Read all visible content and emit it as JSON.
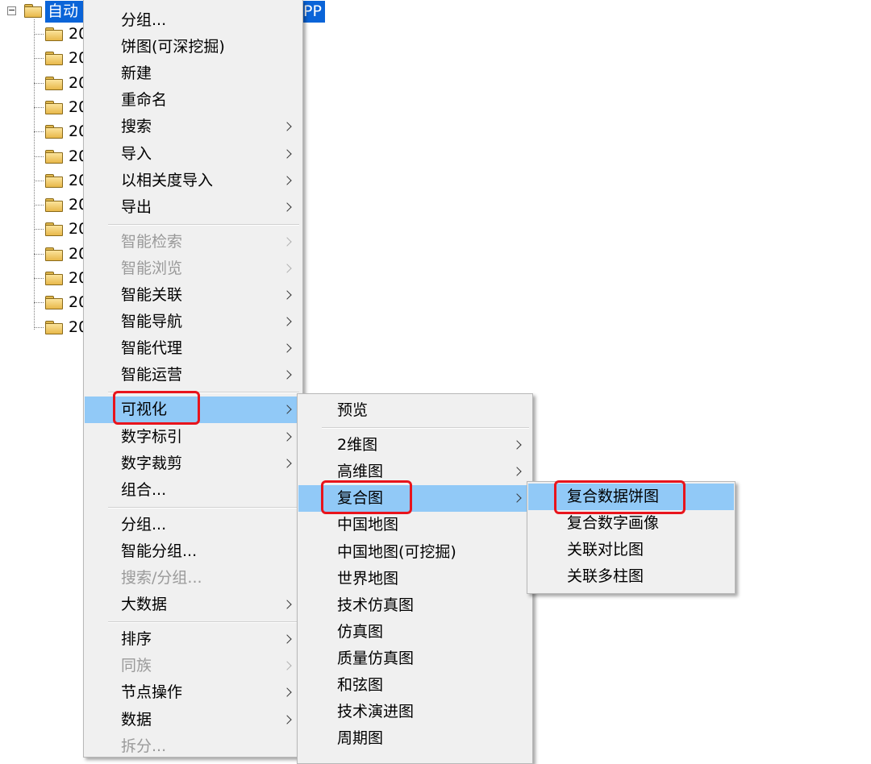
{
  "tree": {
    "root_label": "自动",
    "root_label_tail": "PP",
    "children": [
      "20",
      "20",
      "20",
      "20",
      "20",
      "20",
      "20",
      "20",
      "20",
      "20",
      "20",
      "20",
      "20"
    ]
  },
  "menu1": {
    "items": [
      {
        "label": "分组...",
        "submenu": false,
        "disabled": false
      },
      {
        "label": "饼图(可深挖掘)",
        "submenu": false,
        "disabled": false
      },
      {
        "label": "新建",
        "submenu": false,
        "disabled": false
      },
      {
        "label": "重命名",
        "submenu": false,
        "disabled": false
      },
      {
        "label": "搜索",
        "submenu": true,
        "disabled": false
      },
      {
        "label": "导入",
        "submenu": true,
        "disabled": false
      },
      {
        "label": "以相关度导入",
        "submenu": true,
        "disabled": false
      },
      {
        "label": "导出",
        "submenu": true,
        "disabled": false
      },
      {
        "label": "智能检索",
        "submenu": true,
        "disabled": true
      },
      {
        "label": "智能浏览",
        "submenu": true,
        "disabled": true
      },
      {
        "label": "智能关联",
        "submenu": true,
        "disabled": false
      },
      {
        "label": "智能导航",
        "submenu": true,
        "disabled": false
      },
      {
        "label": "智能代理",
        "submenu": true,
        "disabled": false
      },
      {
        "label": "智能运营",
        "submenu": true,
        "disabled": false
      },
      {
        "label": "可视化",
        "submenu": true,
        "disabled": false,
        "highlighted": true
      },
      {
        "label": "数字标引",
        "submenu": true,
        "disabled": false
      },
      {
        "label": "数字裁剪",
        "submenu": true,
        "disabled": false
      },
      {
        "label": "组合...",
        "submenu": false,
        "disabled": false
      },
      {
        "label": "分组...",
        "submenu": false,
        "disabled": false
      },
      {
        "label": "智能分组...",
        "submenu": false,
        "disabled": false
      },
      {
        "label": "搜索/分组...",
        "submenu": false,
        "disabled": true
      },
      {
        "label": "大数据",
        "submenu": true,
        "disabled": false
      },
      {
        "label": "排序",
        "submenu": true,
        "disabled": false
      },
      {
        "label": "同族",
        "submenu": true,
        "disabled": true
      },
      {
        "label": "节点操作",
        "submenu": true,
        "disabled": false
      },
      {
        "label": "数据",
        "submenu": true,
        "disabled": false
      },
      {
        "label": "拆分...",
        "submenu": false,
        "disabled": true
      }
    ]
  },
  "menu2": {
    "items": [
      {
        "label": "预览",
        "submenu": false
      },
      {
        "label": "2维图",
        "submenu": true
      },
      {
        "label": "高维图",
        "submenu": true
      },
      {
        "label": "复合图",
        "submenu": true,
        "highlighted": true
      },
      {
        "label": "中国地图",
        "submenu": false
      },
      {
        "label": "中国地图(可挖掘)",
        "submenu": false
      },
      {
        "label": "世界地图",
        "submenu": false
      },
      {
        "label": "技术仿真图",
        "submenu": false
      },
      {
        "label": "仿真图",
        "submenu": false
      },
      {
        "label": "质量仿真图",
        "submenu": false
      },
      {
        "label": "和弦图",
        "submenu": false
      },
      {
        "label": "技术演进图",
        "submenu": false
      },
      {
        "label": "周期图",
        "submenu": false
      }
    ]
  },
  "menu3": {
    "items": [
      {
        "label": "复合数据饼图",
        "highlighted": true
      },
      {
        "label": "复合数字画像"
      },
      {
        "label": "关联对比图"
      },
      {
        "label": "关联多柱图"
      }
    ]
  },
  "colors": {
    "selection_blue": "#0a64d8",
    "menu_highlight": "#91c9f7",
    "annotation_red": "#e8141c",
    "menu_bg": "#f0f0f0",
    "disabled_text": "#9a9a9a"
  }
}
